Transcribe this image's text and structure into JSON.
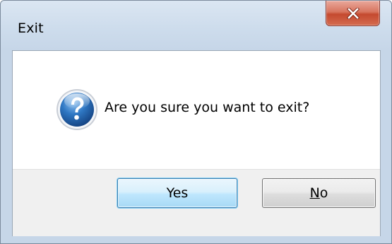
{
  "window": {
    "title": "Exit",
    "close_icon": "close-icon"
  },
  "dialog": {
    "icon": "question-icon",
    "message": "Are you sure you want to exit?"
  },
  "buttons": {
    "yes_label": "Yes",
    "no_mnemonic": "N",
    "no_rest": "o"
  },
  "colors": {
    "close_button": "#c54a2f",
    "default_button_border": "#3c7fb1",
    "question_icon_blue": "#1d5fa8",
    "footer_background": "#f0f0f0",
    "titlebar": "#cddcec"
  }
}
